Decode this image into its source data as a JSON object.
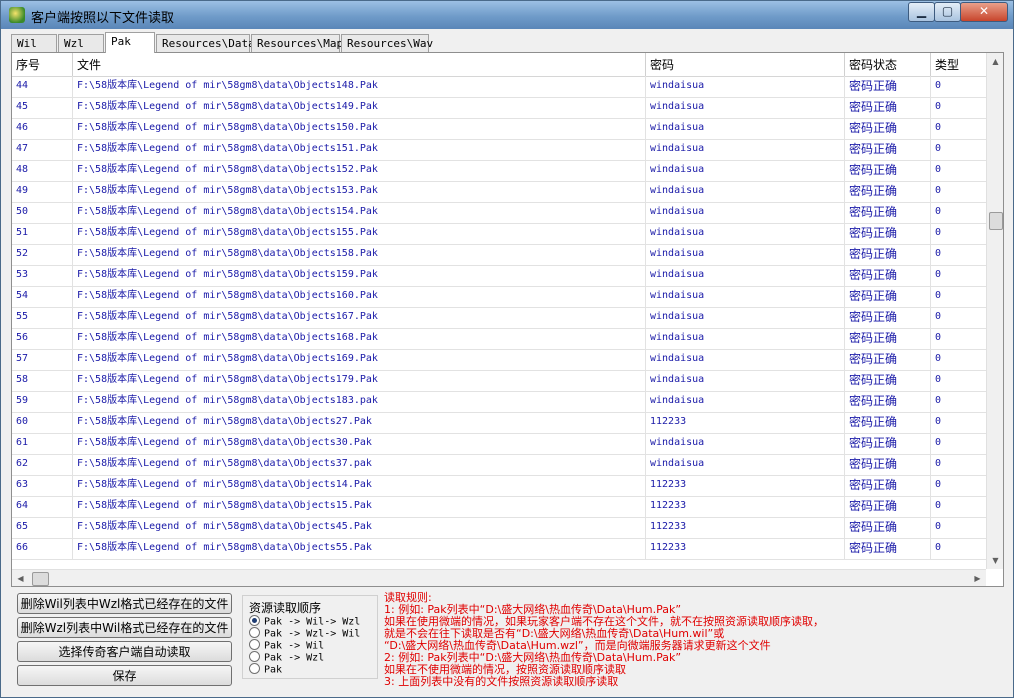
{
  "window": {
    "title": "客户端按照以下文件读取",
    "min": "▁",
    "max": "▢",
    "close": "✕"
  },
  "tabs": [
    "Wil",
    "Wzl",
    "Pak",
    "Resources\\Data",
    "Resources\\Map",
    "Resources\\Wav"
  ],
  "active_tab": "Pak",
  "table": {
    "columns": [
      "序号",
      "文件",
      "密码",
      "密码状态",
      "类型"
    ],
    "rows": [
      [
        "44",
        "F:\\58版本库\\Legend of mir\\58gm8\\data\\Objects148.Pak",
        "windaisua",
        "密码正确",
        "0"
      ],
      [
        "45",
        "F:\\58版本库\\Legend of mir\\58gm8\\data\\Objects149.Pak",
        "windaisua",
        "密码正确",
        "0"
      ],
      [
        "46",
        "F:\\58版本库\\Legend of mir\\58gm8\\data\\Objects150.Pak",
        "windaisua",
        "密码正确",
        "0"
      ],
      [
        "47",
        "F:\\58版本库\\Legend of mir\\58gm8\\data\\Objects151.Pak",
        "windaisua",
        "密码正确",
        "0"
      ],
      [
        "48",
        "F:\\58版本库\\Legend of mir\\58gm8\\data\\Objects152.Pak",
        "windaisua",
        "密码正确",
        "0"
      ],
      [
        "49",
        "F:\\58版本库\\Legend of mir\\58gm8\\data\\Objects153.Pak",
        "windaisua",
        "密码正确",
        "0"
      ],
      [
        "50",
        "F:\\58版本库\\Legend of mir\\58gm8\\data\\Objects154.Pak",
        "windaisua",
        "密码正确",
        "0"
      ],
      [
        "51",
        "F:\\58版本库\\Legend of mir\\58gm8\\data\\Objects155.Pak",
        "windaisua",
        "密码正确",
        "0"
      ],
      [
        "52",
        "F:\\58版本库\\Legend of mir\\58gm8\\data\\Objects158.Pak",
        "windaisua",
        "密码正确",
        "0"
      ],
      [
        "53",
        "F:\\58版本库\\Legend of mir\\58gm8\\data\\Objects159.Pak",
        "windaisua",
        "密码正确",
        "0"
      ],
      [
        "54",
        "F:\\58版本库\\Legend of mir\\58gm8\\data\\Objects160.Pak",
        "windaisua",
        "密码正确",
        "0"
      ],
      [
        "55",
        "F:\\58版本库\\Legend of mir\\58gm8\\data\\Objects167.Pak",
        "windaisua",
        "密码正确",
        "0"
      ],
      [
        "56",
        "F:\\58版本库\\Legend of mir\\58gm8\\data\\Objects168.Pak",
        "windaisua",
        "密码正确",
        "0"
      ],
      [
        "57",
        "F:\\58版本库\\Legend of mir\\58gm8\\data\\Objects169.Pak",
        "windaisua",
        "密码正确",
        "0"
      ],
      [
        "58",
        "F:\\58版本库\\Legend of mir\\58gm8\\data\\Objects179.Pak",
        "windaisua",
        "密码正确",
        "0"
      ],
      [
        "59",
        "F:\\58版本库\\Legend of mir\\58gm8\\data\\Objects183.pak",
        "windaisua",
        "密码正确",
        "0"
      ],
      [
        "60",
        "F:\\58版本库\\Legend of mir\\58gm8\\data\\Objects27.Pak",
        "112233",
        "密码正确",
        "0"
      ],
      [
        "61",
        "F:\\58版本库\\Legend of mir\\58gm8\\data\\Objects30.Pak",
        "windaisua",
        "密码正确",
        "0"
      ],
      [
        "62",
        "F:\\58版本库\\Legend of mir\\58gm8\\data\\Objects37.pak",
        "windaisua",
        "密码正确",
        "0"
      ],
      [
        "63",
        "F:\\58版本库\\Legend of mir\\58gm8\\data\\Objects14.Pak",
        "112233",
        "密码正确",
        "0"
      ],
      [
        "64",
        "F:\\58版本库\\Legend of mir\\58gm8\\data\\Objects15.Pak",
        "112233",
        "密码正确",
        "0"
      ],
      [
        "65",
        "F:\\58版本库\\Legend of mir\\58gm8\\data\\Objects45.Pak",
        "112233",
        "密码正确",
        "0"
      ],
      [
        "66",
        "F:\\58版本库\\Legend of mir\\58gm8\\data\\Objects55.Pak",
        "112233",
        "密码正确",
        "0"
      ]
    ]
  },
  "buttons": {
    "delete_wil": "删除Wil列表中Wzl格式已经存在的文件",
    "delete_wzl": "删除Wzl列表中Wil格式已经存在的文件",
    "select_auto": "选择传奇客户端自动读取",
    "save": "保存"
  },
  "order": {
    "title": "资源读取顺序",
    "options": [
      "Pak -> Wil-> Wzl",
      "Pak -> Wzl-> Wil",
      "Pak -> Wil",
      "Pak -> Wzl",
      "Pak"
    ],
    "selected_index": 0
  },
  "rules": [
    "读取规则:",
    "1: 例如: Pak列表中“D:\\盛大网络\\热血传奇\\Data\\Hum.Pak”",
    "    如果在使用微端的情况，如果玩家客户端不存在这个文件，就不在按照资源读取顺序读取，",
    "    就是不会在往下读取是否有“D:\\盛大网络\\热血传奇\\Data\\Hum.wil”或",
    "    “D:\\盛大网络\\热血传奇\\Data\\Hum.wzl”，而是向微端服务器请求更新这个文件",
    "2: 例如: Pak列表中“D:\\盛大网络\\热血传奇\\Data\\Hum.Pak”",
    "    如果在不使用微端的情况，按照资源读取顺序读取",
    "3: 上面列表中没有的文件按照资源读取顺序读取"
  ],
  "colors": {
    "row_text": "#1a1aa8",
    "rules_text": "#e00000"
  }
}
